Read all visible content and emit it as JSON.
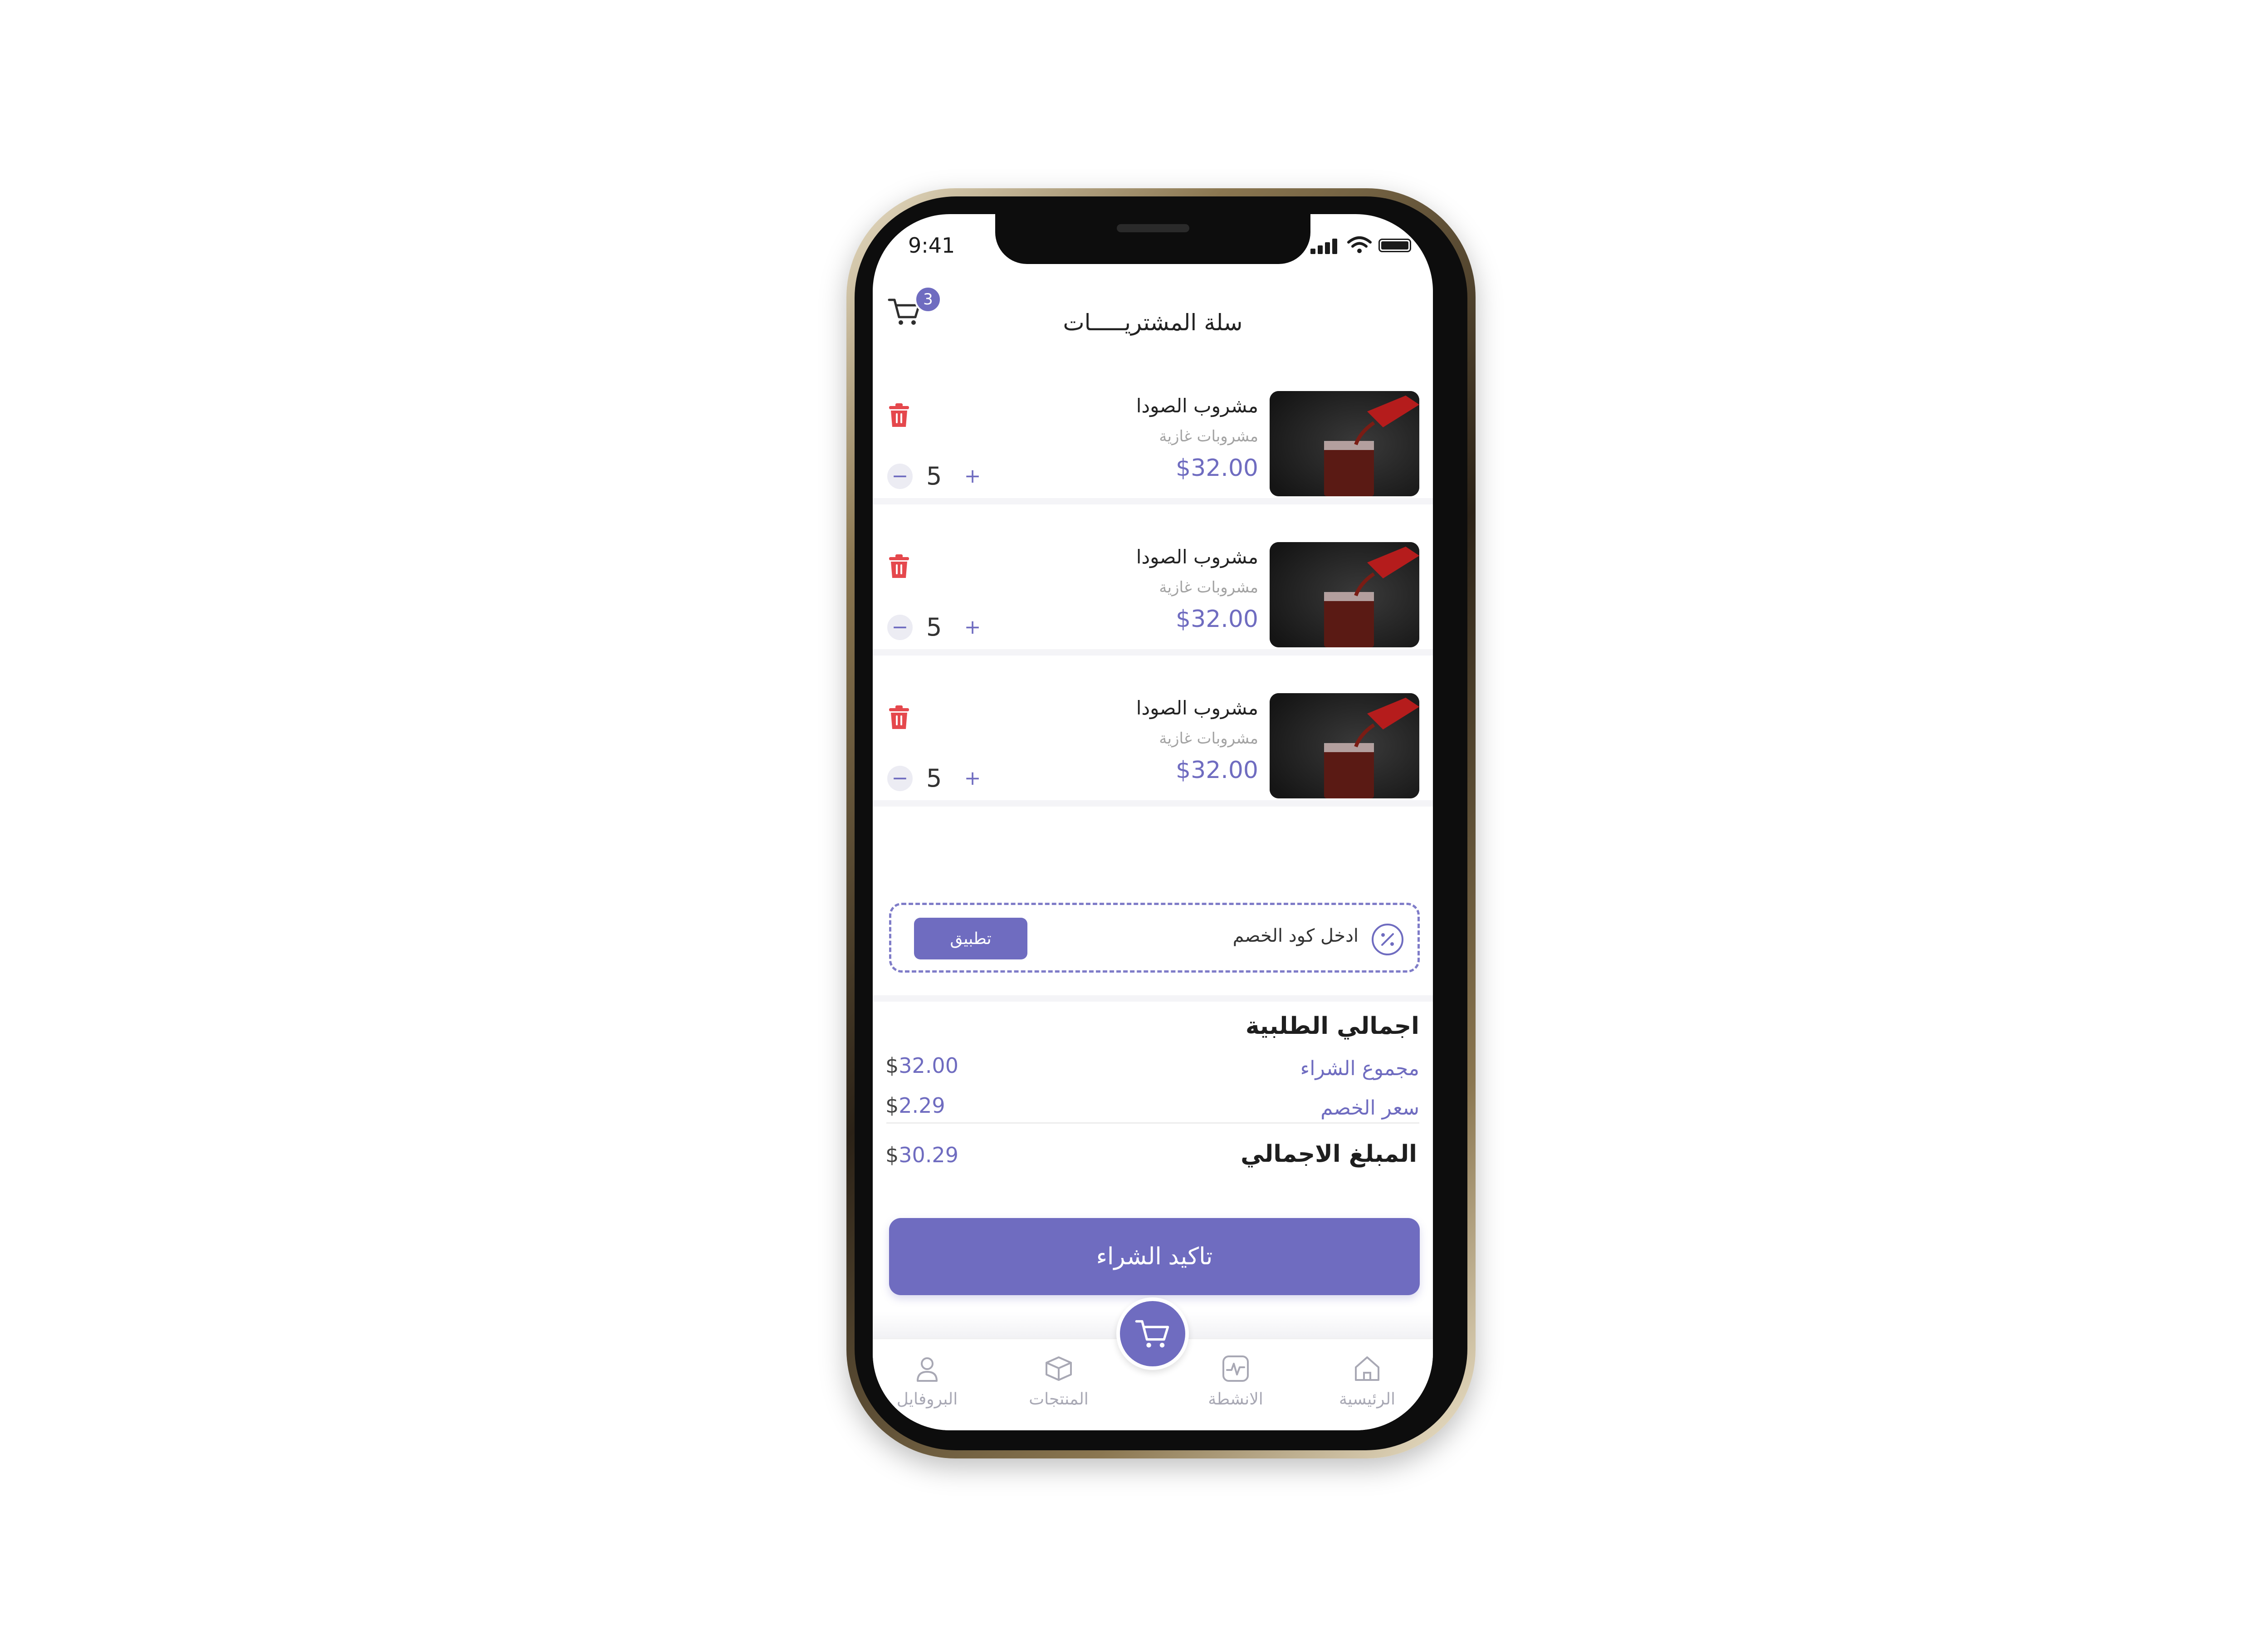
{
  "status_bar": {
    "time": "9:41"
  },
  "header": {
    "title": "سلة المشتريـــــات",
    "cart_count": "3"
  },
  "cart_items": [
    {
      "name": "مشروب الصودا",
      "category": "مشروبات غازية",
      "price": "$32.00",
      "quantity": "5"
    },
    {
      "name": "مشروب الصودا",
      "category": "مشروبات غازية",
      "price": "$32.00",
      "quantity": "5"
    },
    {
      "name": "مشروب الصودا",
      "category": "مشروبات غازية",
      "price": "$32.00",
      "quantity": "5"
    }
  ],
  "qty_controls": {
    "minus": "−",
    "plus": "+"
  },
  "coupon": {
    "placeholder": "ادخل كود الخصم",
    "apply_label": "تطبيق"
  },
  "summary": {
    "title": "اجمالي الطلبية",
    "subtotal_label": "مجموع الشراء",
    "subtotal_currency": "$",
    "subtotal_value": "32.00",
    "discount_label": "سعر الخصم",
    "discount_currency": "$",
    "discount_value": "2.29",
    "total_label": "المبلغ الاجمالي",
    "total_currency": "$",
    "total_value": "30.29"
  },
  "confirm_button": "تاكيد الشراء",
  "bottom_nav": [
    {
      "label": "البروفايل",
      "icon": "user-icon"
    },
    {
      "label": "المنتجات",
      "icon": "box-icon"
    },
    {
      "label": "الانشطة",
      "icon": "activity-icon"
    },
    {
      "label": "الرئيسية",
      "icon": "home-icon"
    }
  ],
  "colors": {
    "accent": "#6f6cc0",
    "delete": "#e5484d",
    "muted": "#a8a8b4"
  }
}
